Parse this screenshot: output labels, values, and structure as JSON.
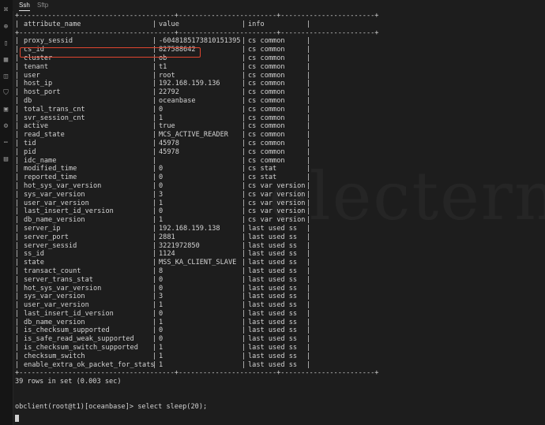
{
  "tabs": {
    "ssh": "Ssh",
    "sftp": "Sftp"
  },
  "sidebar": {
    "icons": [
      "terminal-icon",
      "add-icon",
      "file-icon",
      "table-icon",
      "database-icon",
      "shield-icon",
      "image-icon",
      "gear-icon",
      "more-icon",
      "chart-icon"
    ]
  },
  "table": {
    "border_line": "+--------------------------------------+------------------------+-----------------------+",
    "headers": [
      "attribute_name",
      "value",
      "info"
    ],
    "rows": [
      [
        "proxy_sessid",
        "-6048185173810151395",
        "cs common"
      ],
      [
        "cs_id",
        "827588642",
        "cs common"
      ],
      [
        "cluster",
        "ob",
        "cs common"
      ],
      [
        "tenant",
        "t1",
        "cs common"
      ],
      [
        "user",
        "root",
        "cs common"
      ],
      [
        "host_ip",
        "192.168.159.136",
        "cs common"
      ],
      [
        "host_port",
        "22792",
        "cs common"
      ],
      [
        "db",
        "oceanbase",
        "cs common"
      ],
      [
        "total_trans_cnt",
        "0",
        "cs common"
      ],
      [
        "svr_session_cnt",
        "1",
        "cs common"
      ],
      [
        "active",
        "true",
        "cs common"
      ],
      [
        "read_state",
        "MCS_ACTIVE_READER",
        "cs common"
      ],
      [
        "tid",
        "45978",
        "cs common"
      ],
      [
        "pid",
        "45978",
        "cs common"
      ],
      [
        "idc_name",
        "",
        "cs common"
      ],
      [
        "modified_time",
        "0",
        "cs stat"
      ],
      [
        "reported_time",
        "0",
        "cs stat"
      ],
      [
        "hot_sys_var_version",
        "0",
        "cs var version"
      ],
      [
        "sys_var_version",
        "3",
        "cs var version"
      ],
      [
        "user_var_version",
        "1",
        "cs var version"
      ],
      [
        "last_insert_id_version",
        "0",
        "cs var version"
      ],
      [
        "db_name_version",
        "1",
        "cs var version"
      ],
      [
        "server_ip",
        "192.168.159.138",
        "last used ss"
      ],
      [
        "server_port",
        "2881",
        "last used ss"
      ],
      [
        "server_sessid",
        "3221972850",
        "last used ss"
      ],
      [
        "ss_id",
        "1124",
        "last used ss"
      ],
      [
        "state",
        "MSS_KA_CLIENT_SLAVE",
        "last used ss"
      ],
      [
        "transact_count",
        "8",
        "last used ss"
      ],
      [
        "server_trans_stat",
        "0",
        "last used ss"
      ],
      [
        "hot_sys_var_version",
        "0",
        "last used ss"
      ],
      [
        "sys_var_version",
        "3",
        "last used ss"
      ],
      [
        "user_var_version",
        "1",
        "last used ss"
      ],
      [
        "last_insert_id_version",
        "0",
        "last used ss"
      ],
      [
        "db_name_version",
        "1",
        "last used ss"
      ],
      [
        "is_checksum_supported",
        "0",
        "last used ss"
      ],
      [
        "is_safe_read_weak_supported",
        "0",
        "last used ss"
      ],
      [
        "is_checksum_switch_supported",
        "1",
        "last used ss"
      ],
      [
        "checksum_switch",
        "1",
        "last used ss"
      ],
      [
        "enable_extra_ok_packet_for_stats",
        "1",
        "last used ss"
      ]
    ]
  },
  "result_line": "39 rows in set (0.003 sec)",
  "prompt": "obclient(root@t1)[oceanbase]>",
  "command": "select sleep(20);",
  "watermark": "electern",
  "colors": {
    "highlight": "#e0452f",
    "background": "#1d1d1d"
  }
}
